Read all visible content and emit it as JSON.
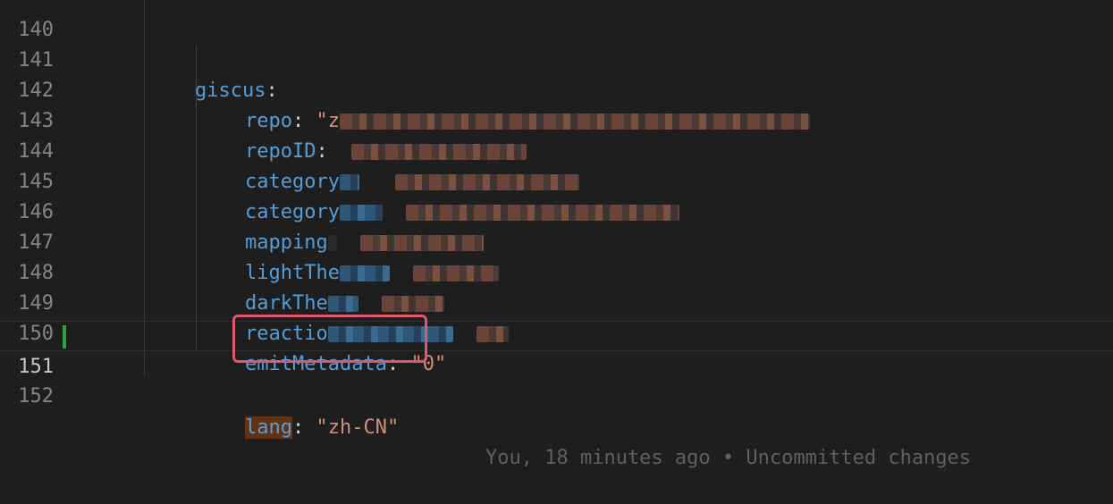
{
  "lines": [
    {
      "num": "140"
    },
    {
      "num": "141",
      "key": "giscus",
      "colon": ":"
    },
    {
      "num": "142",
      "key": "repo",
      "colon": ":",
      "value_visible": "\"z"
    },
    {
      "num": "143",
      "key": "repoID",
      "colon": ":"
    },
    {
      "num": "144",
      "key": "category"
    },
    {
      "num": "145",
      "key": "category"
    },
    {
      "num": "146",
      "key": "mapping"
    },
    {
      "num": "147",
      "key": "lightThe"
    },
    {
      "num": "148",
      "key": "darkThe"
    },
    {
      "num": "149",
      "key": "reactio"
    },
    {
      "num": "150",
      "key": "emitMetadata",
      "colon": ":",
      "value": "\"0\""
    },
    {
      "num": "151",
      "key": "lang",
      "colon": ":",
      "value": "\"zh-CN\"",
      "blame": "You, 18 minutes ago • Uncommitted changes"
    },
    {
      "num": "152"
    }
  ],
  "colors": {
    "background": "#1e1e1e",
    "key": "#569cd6",
    "string": "#ce9178",
    "line_number": "#858585",
    "git_added": "#2ea043",
    "annotation_box": "#e0566f"
  }
}
